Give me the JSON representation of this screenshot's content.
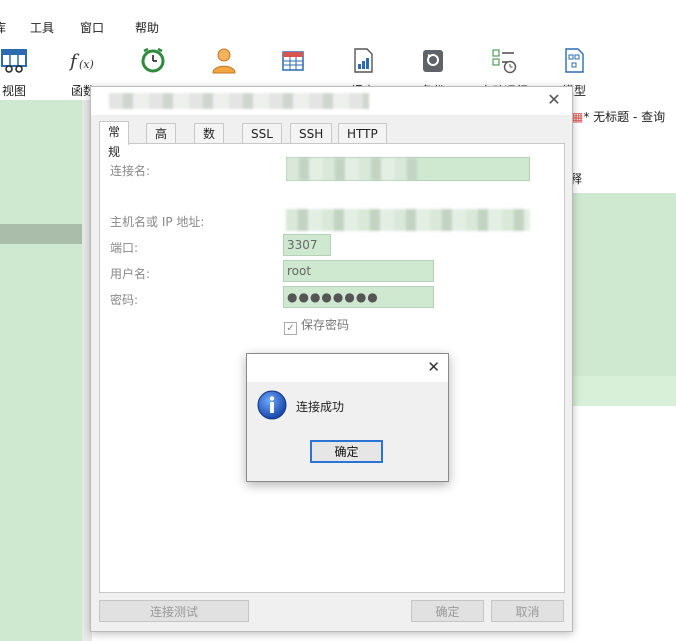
{
  "menubar": {
    "items": [
      "库",
      "工具",
      "窗口",
      "帮助"
    ]
  },
  "toolbar": {
    "items": [
      {
        "label": "视图",
        "icon": "view-icon"
      },
      {
        "label": "函数",
        "icon": "function-icon"
      },
      {
        "label": "",
        "icon": "event-icon"
      },
      {
        "label": "",
        "icon": "user-icon"
      },
      {
        "label": "",
        "icon": "query-icon"
      },
      {
        "label": "报表",
        "icon": "report-icon"
      },
      {
        "label": "备份",
        "icon": "backup-icon"
      },
      {
        "label": "自动运行",
        "icon": "schedule-icon"
      },
      {
        "label": "模型",
        "icon": "model-icon"
      }
    ]
  },
  "right_pane": {
    "tab_label": "* 无标题 - 查询",
    "text": "释"
  },
  "dialog": {
    "tabs": [
      "常规",
      "高级",
      "数据库",
      "SSL",
      "SSH",
      "HTTP"
    ],
    "active_tab": "常规",
    "fields": {
      "conn_name_label": "连接名:",
      "host_label": "主机名或 IP 地址:",
      "port_label": "端口:",
      "port_value": "3307",
      "user_label": "用户名:",
      "user_value": "root",
      "password_label": "密码:",
      "password_value": "●●●●●●●●",
      "save_password_label": "保存密码"
    },
    "buttons": {
      "test": "连接测试",
      "ok": "确定",
      "cancel": "取消"
    }
  },
  "message_box": {
    "text": "连接成功",
    "ok_label": "确定"
  },
  "colors": {
    "field_bg": "#cfe9d0",
    "accent": "#2a74d4",
    "pane_green": "#cfe9d0"
  }
}
